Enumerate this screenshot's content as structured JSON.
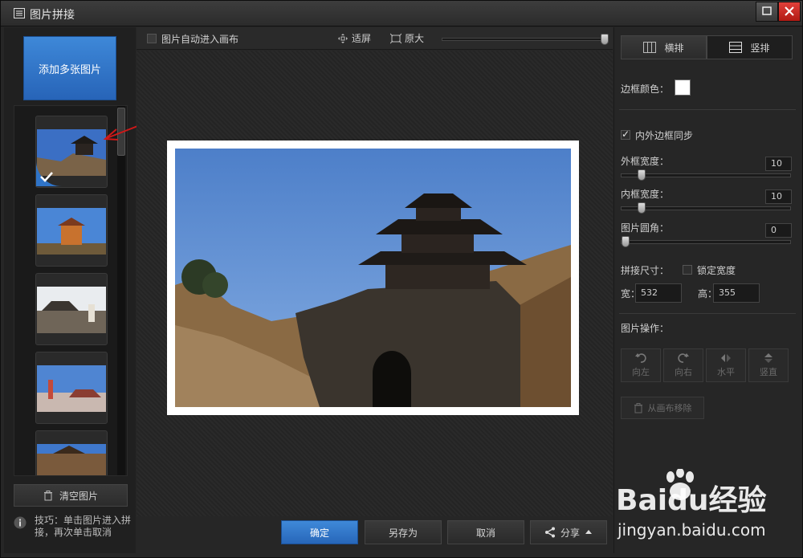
{
  "window": {
    "title": "图片拼接"
  },
  "left": {
    "add_button": "添加多张图片",
    "clear_button": "清空图片",
    "tip": "技巧：单击图片进入拼接，再次单击取消"
  },
  "toolbar": {
    "auto_canvas_label": "图片自动进入画布",
    "fit_label": "适屏",
    "original_label": "原大"
  },
  "bottom": {
    "ok": "确定",
    "save_as": "另存为",
    "cancel": "取消",
    "share": "分享"
  },
  "right": {
    "horizontal": "横排",
    "vertical": "竖排",
    "border_color_label": "边框颜色：",
    "border_color": "#ffffff",
    "sync_label": "内外边框同步",
    "outer_width_label": "外框宽度：",
    "outer_width": "10",
    "inner_width_label": "内框宽度：",
    "inner_width": "10",
    "corner_label": "图片圆角：",
    "corner": "0",
    "size_label": "拼接尺寸：",
    "lock_width_label": "锁定宽度",
    "width_label": "宽：",
    "width_value": "532",
    "height_label": "高：",
    "height_value": "355",
    "ops_label": "图片操作：",
    "ops": [
      "向左",
      "向右",
      "水平",
      "竖直"
    ],
    "remove": "从画布移除"
  },
  "watermark": {
    "brand": "Baidu经验",
    "url": "jingyan.baidu.com"
  },
  "colors": {
    "accent": "#2f74c8",
    "close": "#c9231d"
  }
}
